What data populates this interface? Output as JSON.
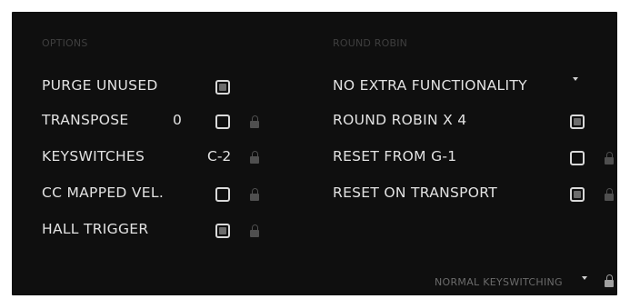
{
  "options": {
    "title": "OPTIONS",
    "purge_unused": {
      "label": "PURGE UNUSED",
      "checked": true
    },
    "transpose": {
      "label": "TRANSPOSE",
      "value": "0",
      "checked": false
    },
    "keyswitches": {
      "label": "KEYSWITCHES",
      "value": "C-2"
    },
    "cc_mapped_vel": {
      "label": "CC MAPPED VEL.",
      "checked": false
    },
    "hall_trigger": {
      "label": "HALL TRIGGER",
      "checked": true
    }
  },
  "round_robin": {
    "title": "ROUND ROBIN",
    "mode_dropdown": {
      "value": "NO EXTRA FUNCTIONALITY"
    },
    "round_robin_x4": {
      "label": "ROUND ROBIN X 4",
      "checked": true
    },
    "reset_from": {
      "label": "RESET FROM G-1",
      "checked": false
    },
    "reset_on_transport": {
      "label": "RESET ON TRANSPORT",
      "checked": true
    }
  },
  "keyswitch_mode": {
    "value": "NORMAL KEYSWITCHING"
  },
  "icons": {
    "lock": "lock-icon",
    "dropdown": "caret-down-icon"
  },
  "colors": {
    "panel_bg": "#0f0f0f",
    "text": "#e2e2e2",
    "section_title": "#3f3f3f",
    "checkbox_fill": "#6c6c6c"
  }
}
